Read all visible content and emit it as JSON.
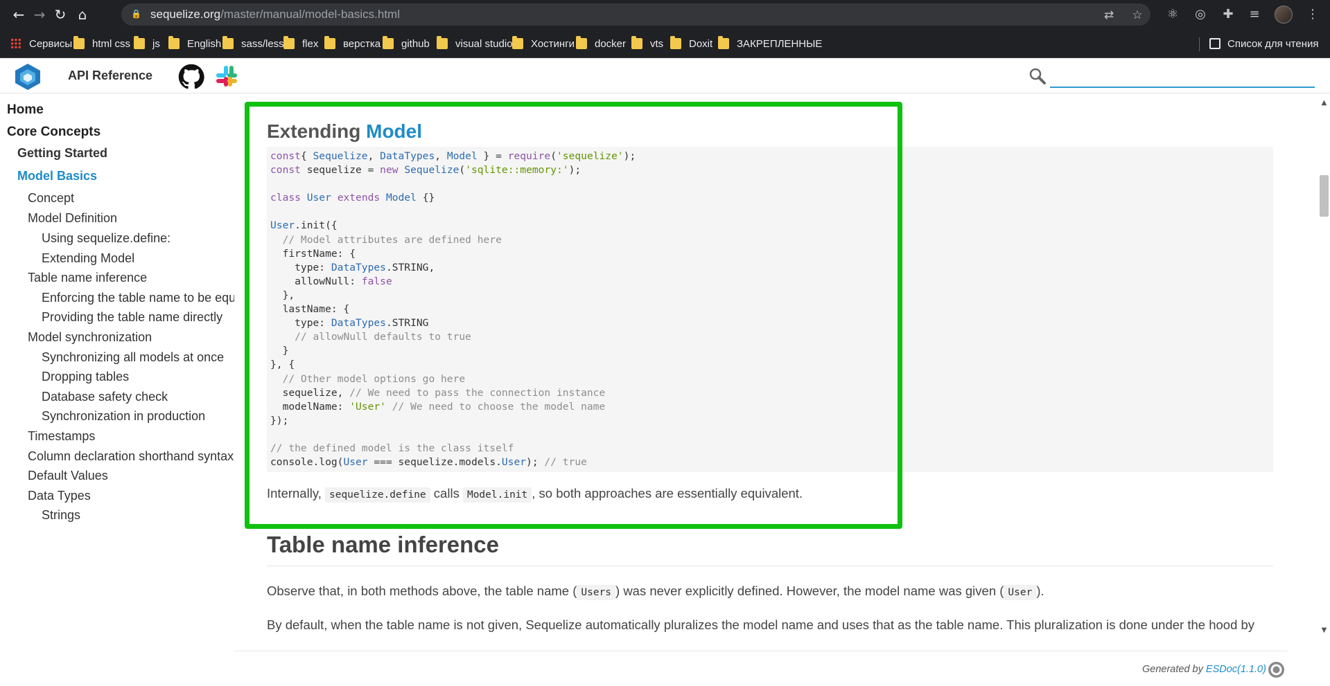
{
  "browser": {
    "url_host": "sequelize.org",
    "url_path": "/master/manual/model-basics.html",
    "bookmarks": [
      {
        "label": "Сервисы",
        "icon": "apps-icon"
      },
      {
        "label": "html css",
        "icon": "folder-icon"
      },
      {
        "label": "js",
        "icon": "folder-icon"
      },
      {
        "label": "English",
        "icon": "folder-icon"
      },
      {
        "label": "sass/less",
        "icon": "folder-icon"
      },
      {
        "label": "flex",
        "icon": "folder-icon"
      },
      {
        "label": "верстка",
        "icon": "folder-icon"
      },
      {
        "label": "github",
        "icon": "folder-icon"
      },
      {
        "label": "visual studio",
        "icon": "folder-icon"
      },
      {
        "label": "Хостинги",
        "icon": "folder-icon"
      },
      {
        "label": "docker",
        "icon": "folder-icon"
      },
      {
        "label": "vts",
        "icon": "folder-icon"
      },
      {
        "label": "Doxit",
        "icon": "folder-icon"
      },
      {
        "label": "ЗАКРЕПЛЕННЫЕ",
        "icon": "folder-icon"
      }
    ],
    "reading_list": "Список для чтения"
  },
  "header": {
    "api_reference": "API Reference",
    "search_placeholder": ""
  },
  "sidebar": {
    "items": [
      {
        "label": "Home",
        "level": 1
      },
      {
        "label": "Core Concepts",
        "level": 1
      },
      {
        "label": "Getting Started",
        "level": 2
      },
      {
        "label": "Model Basics",
        "level": 2,
        "active": true
      },
      {
        "label": "Concept",
        "level": 3
      },
      {
        "label": "Model Definition",
        "level": 3
      },
      {
        "label": "Using sequelize.define:",
        "level": 4
      },
      {
        "label": "Extending Model",
        "level": 4
      },
      {
        "label": "Table name inference",
        "level": 3
      },
      {
        "label": "Enforcing the table name to be equal",
        "level": 4
      },
      {
        "label": "Providing the table name directly",
        "level": 4
      },
      {
        "label": "Model synchronization",
        "level": 3
      },
      {
        "label": "Synchronizing all models at once",
        "level": 4
      },
      {
        "label": "Dropping tables",
        "level": 4
      },
      {
        "label": "Database safety check",
        "level": 4
      },
      {
        "label": "Synchronization in production",
        "level": 4
      },
      {
        "label": "Timestamps",
        "level": 3
      },
      {
        "label": "Column declaration shorthand syntax",
        "level": 3
      },
      {
        "label": "Default Values",
        "level": 3
      },
      {
        "label": "Data Types",
        "level": 3
      },
      {
        "label": "Strings",
        "level": 4
      }
    ]
  },
  "content": {
    "heading_extending_prefix": "Extending ",
    "heading_extending_model": "Model",
    "internally_1": "Internally, ",
    "internally_code1": "sequelize.define",
    "internally_2": " calls ",
    "internally_code2": "Model.init",
    "internally_3": ", so both approaches are essentially equivalent.",
    "heading_table": "Table name inference",
    "observe_1": "Observe that, in both methods above, the table name (",
    "observe_code1": "Users",
    "observe_2": ") was never explicitly defined. However, the model name was given (",
    "observe_code2": "User",
    "observe_3": ").",
    "default_text": "By default, when the table name is not given, Sequelize automatically pluralizes the model name and uses that as the table name. This pluralization is done under the hood by"
  },
  "code_lines": [
    [
      [
        "kw",
        "const"
      ],
      [
        "",
        "{ "
      ],
      [
        "ty",
        "Sequelize"
      ],
      [
        "",
        ", "
      ],
      [
        "ty",
        "DataTypes"
      ],
      [
        "",
        ", "
      ],
      [
        "ty",
        "Model"
      ],
      [
        "",
        " } = "
      ],
      [
        "kw",
        "require"
      ],
      [
        "",
        "("
      ],
      [
        "st",
        "'sequelize'"
      ],
      [
        "",
        ");"
      ]
    ],
    [
      [
        "kw",
        "const"
      ],
      [
        "",
        " sequelize = "
      ],
      [
        "kw",
        "new"
      ],
      [
        "",
        " "
      ],
      [
        "ty",
        "Sequelize"
      ],
      [
        "",
        "("
      ],
      [
        "st",
        "'sqlite::memory:'"
      ],
      [
        "",
        ");"
      ]
    ],
    [],
    [
      [
        "kw",
        "class"
      ],
      [
        "",
        " "
      ],
      [
        "ty",
        "User"
      ],
      [
        "",
        " "
      ],
      [
        "kw",
        "extends"
      ],
      [
        "",
        " "
      ],
      [
        "ty",
        "Model"
      ],
      [
        "",
        " {}"
      ]
    ],
    [],
    [
      [
        "ty",
        "User"
      ],
      [
        "",
        ".init({"
      ]
    ],
    [
      [
        "",
        "  "
      ],
      [
        "cm",
        "// Model attributes are defined here"
      ]
    ],
    [
      [
        "",
        "  firstName: {"
      ]
    ],
    [
      [
        "",
        "    type: "
      ],
      [
        "ty",
        "DataTypes"
      ],
      [
        "",
        ".STRING,"
      ]
    ],
    [
      [
        "",
        "    allowNull: "
      ],
      [
        "bo",
        "false"
      ]
    ],
    [
      [
        "",
        "  },"
      ]
    ],
    [
      [
        "",
        "  lastName: {"
      ]
    ],
    [
      [
        "",
        "    type: "
      ],
      [
        "ty",
        "DataTypes"
      ],
      [
        "",
        ".STRING"
      ]
    ],
    [
      [
        "",
        "    "
      ],
      [
        "cm",
        "// allowNull defaults to true"
      ]
    ],
    [
      [
        "",
        "  }"
      ]
    ],
    [
      [
        "",
        "}, {"
      ]
    ],
    [
      [
        "",
        "  "
      ],
      [
        "cm",
        "// Other model options go here"
      ]
    ],
    [
      [
        "",
        "  sequelize, "
      ],
      [
        "cm",
        "// We need to pass the connection instance"
      ]
    ],
    [
      [
        "",
        "  modelName: "
      ],
      [
        "st",
        "'User'"
      ],
      [
        "",
        " "
      ],
      [
        "cm",
        "// We need to choose the model name"
      ]
    ],
    [
      [
        "",
        "});"
      ]
    ],
    [],
    [
      [
        "cm",
        "// the defined model is the class itself"
      ]
    ],
    [
      [
        "",
        "console.log("
      ],
      [
        "ty",
        "User"
      ],
      [
        "",
        " === sequelize.models."
      ],
      [
        "ty",
        "User"
      ],
      [
        "",
        "); "
      ],
      [
        "cm",
        "// true"
      ]
    ]
  ],
  "footer": {
    "generated_by": "Generated by ",
    "esdoc": "ESDoc(1.1.0)"
  }
}
